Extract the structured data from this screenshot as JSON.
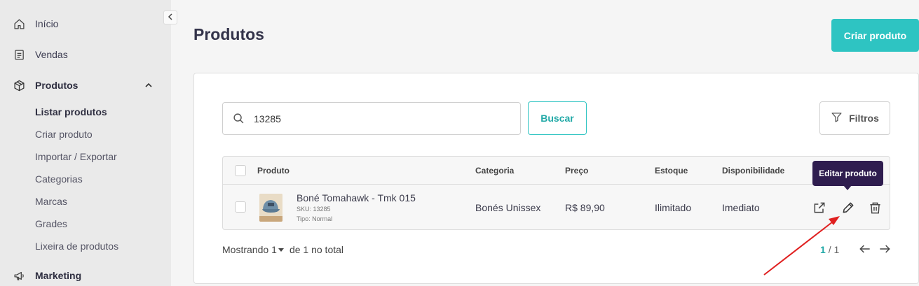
{
  "sidebar": {
    "collapse_icon": "chevron-left-icon",
    "items": [
      {
        "label": "Início",
        "icon": "home-icon"
      },
      {
        "label": "Vendas",
        "icon": "receipt-icon"
      },
      {
        "label": "Produtos",
        "icon": "box-icon"
      },
      {
        "label": "Marketing",
        "icon": "megaphone-icon"
      }
    ],
    "produtos_submenu": [
      "Listar produtos",
      "Criar produto",
      "Importar / Exportar",
      "Categorias",
      "Marcas",
      "Grades",
      "Lixeira de produtos"
    ]
  },
  "header": {
    "title": "Produtos",
    "create_button": "Criar produto"
  },
  "search": {
    "value": "13285",
    "button": "Buscar",
    "filters_button": "Filtros"
  },
  "table": {
    "columns": [
      "Produto",
      "Categoria",
      "Preço",
      "Estoque",
      "Disponibilidade"
    ],
    "rows": [
      {
        "name": "Boné Tomahawk - Tmk 015",
        "sku": "SKU: 13285",
        "type": "Tipo: Normal",
        "category": "Bonés Unissex",
        "price": "R$ 89,90",
        "stock": "Ilimitado",
        "availability": "Imediato"
      }
    ]
  },
  "tooltip": "Editar produto",
  "footer": {
    "showing_prefix": "Mostrando",
    "per_page": "1",
    "total_text": "de 1 no total",
    "current_page": "1",
    "page_sep": "/",
    "total_pages": "1"
  },
  "colors": {
    "accent": "#2ec4c2",
    "tooltip_bg": "#2f1d4f",
    "annotation_arrow": "#e02020"
  }
}
